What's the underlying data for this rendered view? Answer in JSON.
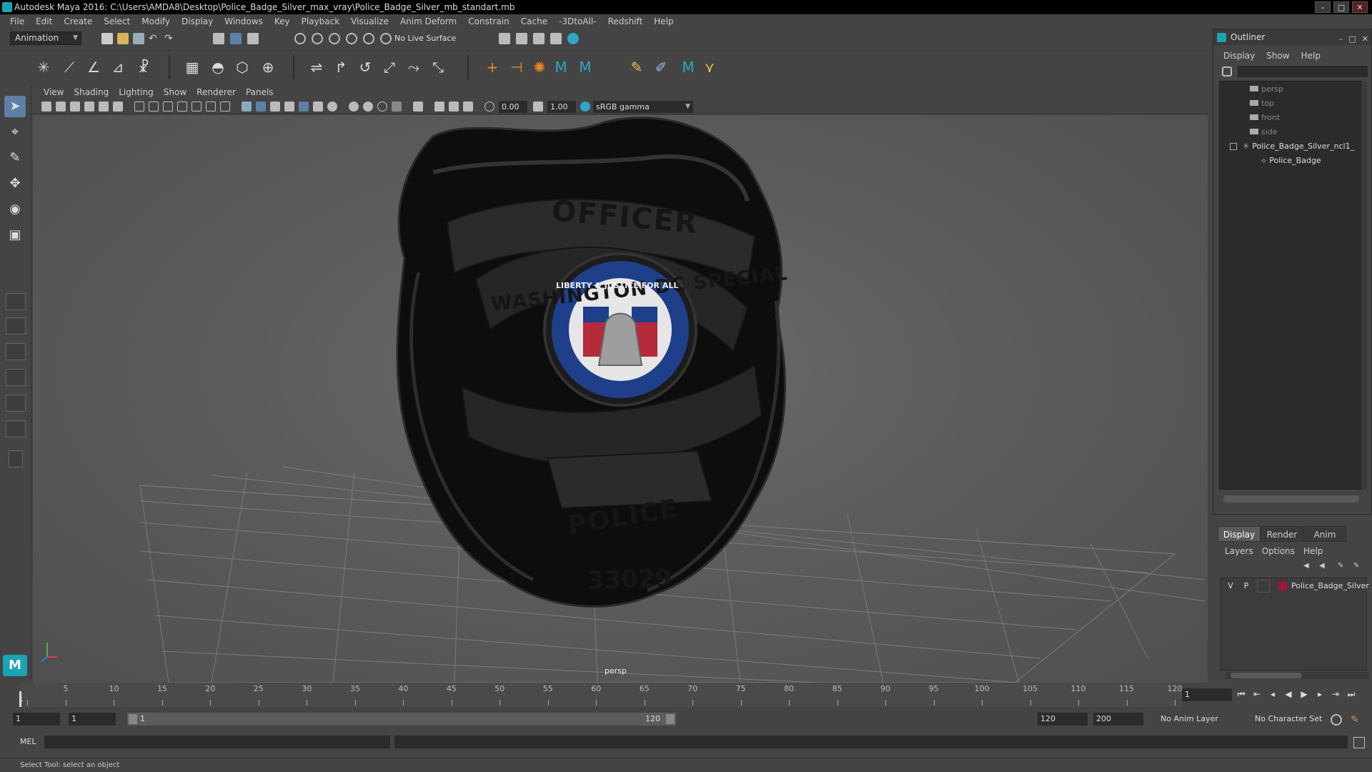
{
  "window": {
    "title": "Autodesk Maya 2016: C:\\Users\\AMDA8\\Desktop\\Police_Badge_Silver_max_vray\\Police_Badge_Silver_mb_standart.mb",
    "controls": [
      "–",
      "□",
      "✕"
    ]
  },
  "menubar": {
    "items": [
      "File",
      "Edit",
      "Create",
      "Select",
      "Modify",
      "Display",
      "Windows",
      "Key",
      "Playback",
      "Visualize",
      "Anim Deform",
      "Constrain",
      "Cache",
      "-3DtoAll-",
      "Redshift",
      "Help"
    ]
  },
  "statusline": {
    "mode": "Animation",
    "live_surface": "No Live Surface"
  },
  "panel": {
    "menu": [
      "View",
      "Shading",
      "Lighting",
      "Show",
      "Renderer",
      "Panels"
    ],
    "exposure": "0.00",
    "gamma": "1.00",
    "color_space": "sRGB gamma",
    "camera_label": "persp"
  },
  "badge": {
    "top_text": "OFFICER",
    "banner_text": "WASHINGTON DC SPECIAL",
    "seal_text": "LIBERTY & JUSTICE FOR ALL",
    "bottom_text": "POLICE",
    "number": "33029"
  },
  "outliner": {
    "title": "Outliner",
    "menu": [
      "Display",
      "Show",
      "Help"
    ],
    "items": [
      {
        "label": "persp",
        "icon": "camera-icon"
      },
      {
        "label": "top",
        "icon": "camera-icon"
      },
      {
        "label": "front",
        "icon": "camera-icon"
      },
      {
        "label": "side",
        "icon": "camera-icon"
      },
      {
        "label": "Police_Badge_Silver_ncl1_",
        "icon": "group-icon"
      },
      {
        "label": "Police_Badge",
        "icon": "mesh-icon"
      }
    ]
  },
  "layers": {
    "tabs": [
      "Display",
      "Render",
      "Anim"
    ],
    "menu": [
      "Layers",
      "Options",
      "Help"
    ],
    "rows": [
      {
        "v": "V",
        "p": "P",
        "name": "Police_Badge_Silver",
        "color": "#a0173a"
      }
    ]
  },
  "timeslider": {
    "ticks": [
      1,
      5,
      10,
      15,
      20,
      25,
      30,
      35,
      40,
      45,
      50,
      55,
      60,
      65,
      70,
      75,
      80,
      85,
      90,
      95,
      100,
      105,
      110,
      115,
      120
    ],
    "current_frame": "1",
    "current_field": "1"
  },
  "rangeslider": {
    "start": "1",
    "playback_start": "1",
    "range_start_label": "1",
    "range_end_label": "120",
    "playback_end": "120",
    "end": "200",
    "anim_layer": "No Anim Layer",
    "character_set": "No Character Set"
  },
  "cmdline": {
    "label": "MEL"
  },
  "helpline": {
    "text": "Select Tool: select an object"
  },
  "colors": {
    "accent": "#5e7fa8",
    "maya_teal": "#1aa3b5",
    "layer_color": "#a0173a"
  }
}
